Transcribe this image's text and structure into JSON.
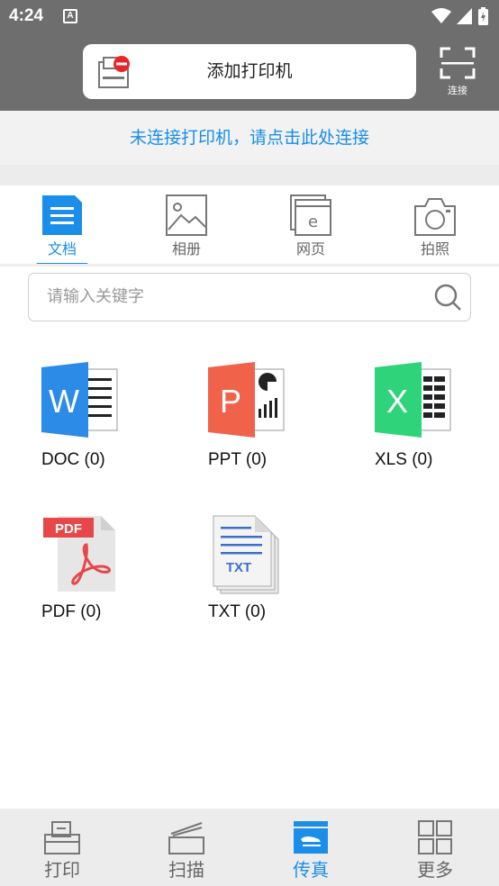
{
  "status_bar": {
    "time": "4:24",
    "notification_letter": "A"
  },
  "header": {
    "add_printer_label": "添加打印机",
    "scan_connect_label": "连接"
  },
  "connect_banner": {
    "text": "未连接打印机，请点击此处连接"
  },
  "tabs": [
    {
      "label": "文档",
      "icon": "document-icon",
      "active": true
    },
    {
      "label": "相册",
      "icon": "image-icon",
      "active": false
    },
    {
      "label": "网页",
      "icon": "webpage-icon",
      "active": false
    },
    {
      "label": "拍照",
      "icon": "camera-icon",
      "active": false
    }
  ],
  "search": {
    "placeholder": "请输入关键字"
  },
  "files": [
    {
      "label": "DOC (0)",
      "icon": "word-doc-icon",
      "color": "#2b8be6",
      "letter": "W"
    },
    {
      "label": "PPT (0)",
      "icon": "powerpoint-icon",
      "color": "#f0624a",
      "letter": "P"
    },
    {
      "label": "XLS (0)",
      "icon": "excel-icon",
      "color": "#2fd47a",
      "letter": "X"
    },
    {
      "label": "PDF (0)",
      "icon": "pdf-icon",
      "color": "#e8474a",
      "letter": "PDF"
    },
    {
      "label": "TXT (0)",
      "icon": "txt-icon",
      "color": "#3d6fc9",
      "letter": "TXT"
    }
  ],
  "bottom_nav": [
    {
      "label": "打印",
      "icon": "printer-icon",
      "active": false
    },
    {
      "label": "扫描",
      "icon": "scanner-icon",
      "active": false
    },
    {
      "label": "传真",
      "icon": "fax-icon",
      "active": true
    },
    {
      "label": "更多",
      "icon": "grid-more-icon",
      "active": false
    }
  ],
  "colors": {
    "accent": "#1a8ee8",
    "header_bg": "#6e6e6e",
    "banner_bg": "#f2f2f2"
  }
}
